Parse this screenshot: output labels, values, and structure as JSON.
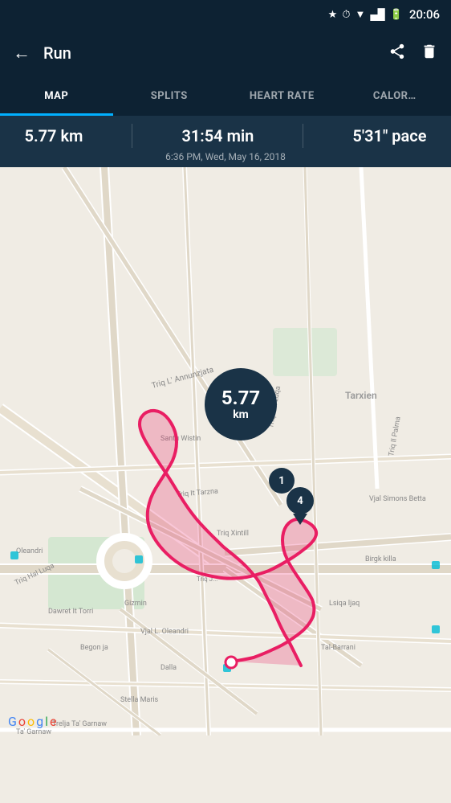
{
  "statusBar": {
    "time": "20:06",
    "icons": [
      "bluetooth",
      "alarm",
      "wifi",
      "signal",
      "battery"
    ]
  },
  "header": {
    "title": "Run",
    "backLabel": "←",
    "shareIcon": "share",
    "deleteIcon": "trash"
  },
  "tabs": [
    {
      "id": "map",
      "label": "MAP",
      "active": true
    },
    {
      "id": "splits",
      "label": "SPLITS",
      "active": false
    },
    {
      "id": "heartrate",
      "label": "HEART RATE",
      "active": false
    },
    {
      "id": "calories",
      "label": "CALOR…",
      "active": false
    }
  ],
  "stats": {
    "distance": "5.77 km",
    "duration": "31:54 min",
    "pace": "5'31\" pace",
    "datetime": "6:36 PM, Wed, May 16, 2018"
  },
  "map": {
    "distanceBubble": {
      "value": "5.77",
      "unit": "km"
    },
    "markers": [
      {
        "label": "1",
        "type": "circle"
      },
      {
        "label": "4",
        "type": "teardrop"
      }
    ]
  },
  "googleWatermark": "Google"
}
